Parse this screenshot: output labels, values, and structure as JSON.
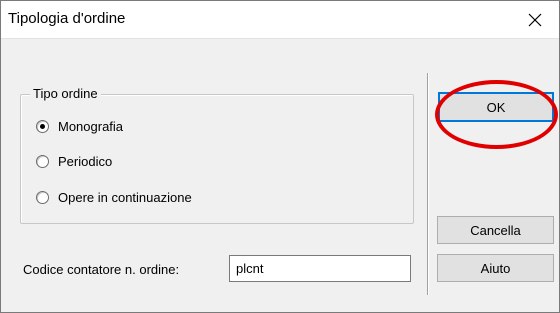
{
  "window": {
    "title": "Tipologia d'ordine"
  },
  "group": {
    "legend": "Tipo ordine",
    "options": [
      {
        "label": "Monografia",
        "checked": true
      },
      {
        "label": "Periodico",
        "checked": false
      },
      {
        "label": "Opere in continuazione",
        "checked": false
      }
    ]
  },
  "buttons": {
    "ok": "OK",
    "cancel": "Cancella",
    "help": "Aiuto"
  },
  "counter": {
    "label": "Codice contatore n. ordine:",
    "value": "plcnt"
  },
  "colors": {
    "annotation_ring": "#e00000",
    "default_button_border": "#0078d7"
  }
}
